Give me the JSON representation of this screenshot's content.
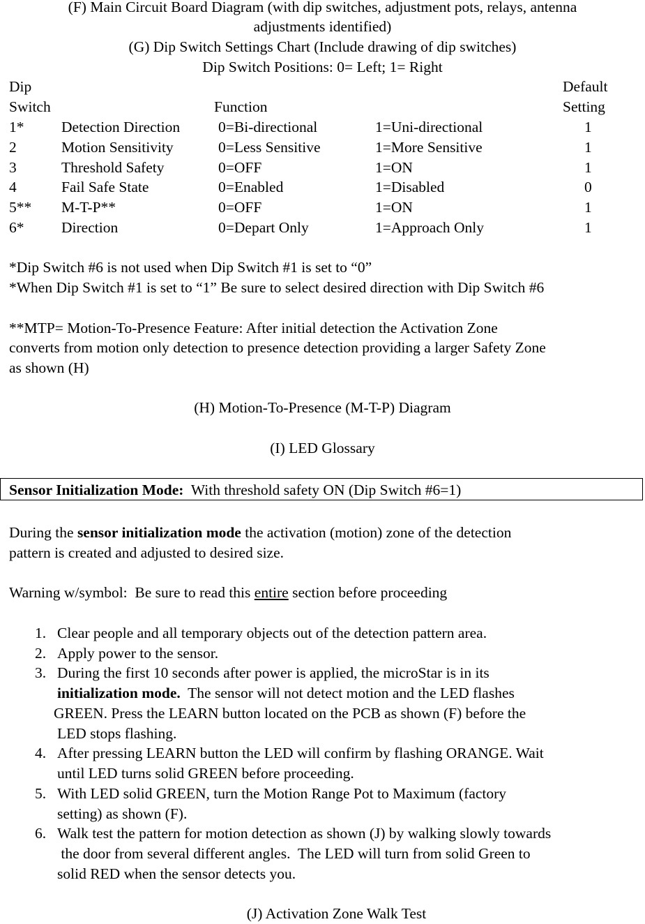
{
  "headings": {
    "f_line1": "(F)  Main Circuit Board Diagram (with dip switches, adjustment pots, relays, antenna",
    "f_line2": "adjustments identified)",
    "g": "(G) Dip Switch Settings Chart (Include drawing of dip switches)",
    "positions": "Dip Switch Positions:  0= Left; 1= Right",
    "h": "(H) Motion-To-Presence (M-T-P) Diagram",
    "i": "(I) LED Glossary",
    "j": "(J) Activation Zone Walk Test"
  },
  "table": {
    "headers": {
      "switch_line1": "Dip",
      "switch_line2": "Switch",
      "function": "Function",
      "default_line1": "Default",
      "default_line2": "Setting"
    },
    "rows": [
      {
        "switch": "1*",
        "function": "Detection Direction",
        "zero": "0=Bi-directional",
        "one": "1=Uni-directional",
        "default": "1"
      },
      {
        "switch": "2",
        "function": "Motion Sensitivity",
        "zero": "0=Less Sensitive",
        "one": "1=More Sensitive",
        "default": "1"
      },
      {
        "switch": "3",
        "function": "Threshold Safety",
        "zero": "0=OFF",
        "one": "1=ON",
        "default": "1"
      },
      {
        "switch": "4",
        "function": "Fail Safe State",
        "zero": "0=Enabled",
        "one": "1=Disabled",
        "default": "0"
      },
      {
        "switch": "5**",
        "function": "M-T-P**",
        "zero": "0=OFF",
        "one": "1=ON",
        "default": "1"
      },
      {
        "switch": "6*",
        "function": "Direction",
        "zero": "0=Depart Only",
        "one": "1=Approach Only",
        "default": "1"
      }
    ]
  },
  "notes": {
    "note1": "*Dip Switch #6 is not used when Dip Switch #1 is set to “0”",
    "note2": "*When Dip Switch #1 is set to “1” Be sure to select desired direction with Dip Switch #6",
    "mtp_line1": "**MTP= Motion-To-Presence Feature:  After initial detection the Activation Zone",
    "mtp_line2": "converts from motion only detection to presence detection providing a larger Safety Zone",
    "mtp_line3": "as shown (H)"
  },
  "init_box": {
    "bold": "Sensor Initialization Mode:",
    "rest": "  With threshold safety ON (Dip Switch #6=1)"
  },
  "during": {
    "pre": "During the ",
    "bold": "sensor initialization mode",
    "post": " the activation (motion) zone of the detection",
    "line2": "pattern is created and adjusted to desired size."
  },
  "warning": {
    "pre": "Warning w/symbol:  Be sure to read this ",
    "underlined": "entire",
    "post": " section before proceeding"
  },
  "steps": {
    "s1": {
      "num": "1.",
      "text": "Clear people and all temporary objects out of the detection pattern area."
    },
    "s2": {
      "num": "2.",
      "text": "Apply power to the sensor."
    },
    "s3": {
      "num": "3.",
      "line1": "During the first 10 seconds after power is applied, the microStar is in its",
      "line2_bold": "initialization mode.",
      "line2_rest": "  The sensor will not detect motion and the LED flashes",
      "line3": "GREEN.  Press the LEARN button located on the PCB as shown (F) before the",
      "line4": "LED stops flashing."
    },
    "s4": {
      "num": "4.",
      "line1": "After pressing LEARN button the LED will confirm by flashing ORANGE.  Wait",
      "line2": "until LED turns solid GREEN before proceeding."
    },
    "s5": {
      "num": "5.",
      "line1": "With LED solid GREEN, turn the Motion Range Pot to Maximum (factory",
      "line2": "setting) as shown (F)."
    },
    "s6": {
      "num": "6.",
      "line1": "Walk test the pattern for motion detection as shown (J) by walking slowly towards",
      "line2": " the door from several different angles.  The LED will turn from solid Green to",
      "line3": "solid RED when the sensor detects you."
    }
  }
}
